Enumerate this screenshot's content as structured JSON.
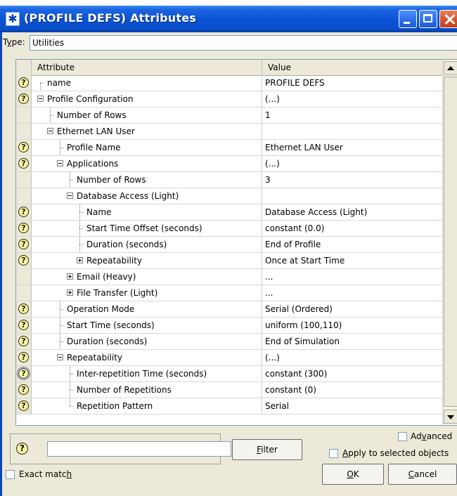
{
  "window": {
    "title": "(PROFILE DEFS) Attributes",
    "app_icon_glyph": "✱"
  },
  "type": {
    "label_prefix": "T",
    "label_accel": "y",
    "label_suffix": "pe:",
    "value": "Utilities"
  },
  "table": {
    "headers": {
      "attribute": "Attribute",
      "value": "Value"
    },
    "rows": [
      {
        "help": true,
        "depth": 0,
        "toggle": "none",
        "attr": "name",
        "value": "PROFILE DEFS"
      },
      {
        "help": true,
        "depth": 0,
        "toggle": "minus",
        "attr": "Profile Configuration",
        "value": "(...)"
      },
      {
        "help": false,
        "depth": 1,
        "toggle": "none",
        "attr": "Number of Rows",
        "value": "1"
      },
      {
        "help": false,
        "depth": 1,
        "toggle": "minus",
        "attr": "Ethernet LAN User",
        "value": ""
      },
      {
        "help": true,
        "depth": 2,
        "toggle": "none",
        "attr": "Profile Name",
        "value": "Ethernet LAN User"
      },
      {
        "help": true,
        "depth": 2,
        "toggle": "minus",
        "attr": "Applications",
        "value": "(...)"
      },
      {
        "help": false,
        "depth": 3,
        "toggle": "none",
        "attr": "Number of Rows",
        "value": "3"
      },
      {
        "help": false,
        "depth": 3,
        "toggle": "minus",
        "attr": "Database Access (Light)",
        "value": ""
      },
      {
        "help": true,
        "depth": 4,
        "toggle": "none",
        "attr": "Name",
        "value": "Database Access (Light)"
      },
      {
        "help": true,
        "depth": 4,
        "toggle": "none",
        "attr": "Start Time Offset (seconds)",
        "value": "constant (0.0)"
      },
      {
        "help": true,
        "depth": 4,
        "toggle": "none",
        "attr": "Duration (seconds)",
        "value": "End of Profile"
      },
      {
        "help": true,
        "depth": 4,
        "toggle": "plus",
        "attr": "Repeatability",
        "value": "Once at Start Time"
      },
      {
        "help": false,
        "depth": 3,
        "toggle": "plus",
        "attr": "Email (Heavy)",
        "value": "..."
      },
      {
        "help": false,
        "depth": 3,
        "toggle": "plus",
        "attr": "File Transfer (Light)",
        "value": "..."
      },
      {
        "help": true,
        "depth": 2,
        "toggle": "none",
        "attr": "Operation Mode",
        "value": "Serial (Ordered)"
      },
      {
        "help": true,
        "depth": 2,
        "toggle": "none",
        "attr": "Start Time (seconds)",
        "value": "uniform (100,110)"
      },
      {
        "help": true,
        "depth": 2,
        "toggle": "none",
        "attr": "Duration (seconds)",
        "value": "End of Simulation"
      },
      {
        "help": true,
        "depth": 2,
        "toggle": "minus",
        "attr": "Repeatability",
        "value": "(...)"
      },
      {
        "help": true,
        "depth": 3,
        "toggle": "none",
        "attr": "Inter-repetition Time (seconds)",
        "value": "constant (300)",
        "focused": true
      },
      {
        "help": true,
        "depth": 3,
        "toggle": "none",
        "attr": "Number of Repetitions",
        "value": "constant (0)"
      },
      {
        "help": true,
        "depth": 3,
        "toggle": "none",
        "attr": "Repetition Pattern",
        "value": "Serial"
      }
    ]
  },
  "help_glyph": "?",
  "search": {
    "value": ""
  },
  "filter": {
    "label_accel": "F",
    "label_rest": "ilter"
  },
  "exact_match": {
    "label_main": "Exact matc",
    "label_accel": "h"
  },
  "advanced": {
    "label_pre": "Ad",
    "label_accel": "v",
    "label_post": "anced"
  },
  "apply": {
    "label_accel": "A",
    "label_rest": "pply to selected objects"
  },
  "ok": {
    "label_accel": "O",
    "label_rest": "K"
  },
  "cancel": {
    "label_accel": "C",
    "label_rest": "ancel"
  },
  "colors": {
    "title_blue": "#0a55d8",
    "dialog_bg": "#ece9d8",
    "help_yellow": "#f7f39a"
  }
}
